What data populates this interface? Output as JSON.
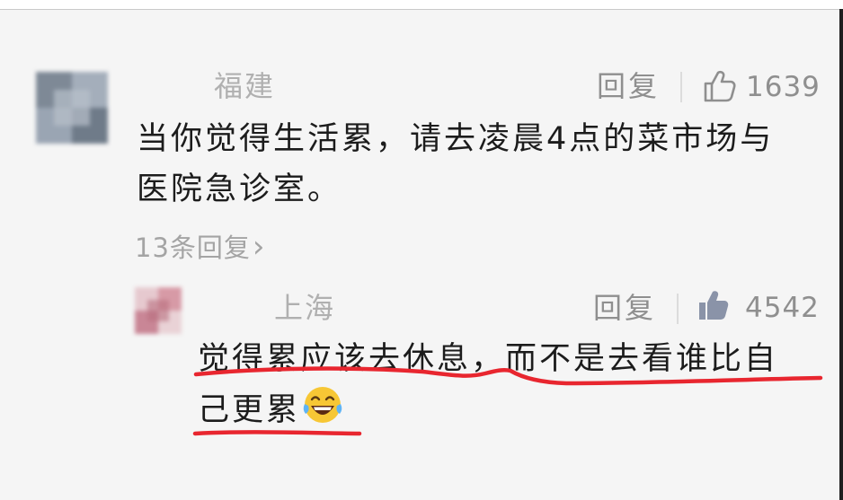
{
  "comment": {
    "username": "福建",
    "reply_label": "回复",
    "like_count": "1639",
    "content_lines": [
      "当你觉得生活累，请去凌晨4点的菜市场与",
      "医院急诊室。"
    ],
    "replies_link": "13条回复",
    "replies_chevron": "›"
  },
  "reply": {
    "username": "上海",
    "reply_label": "回复",
    "like_count": "4542",
    "content_lines": [
      "觉得累应该去休息，而不是去看谁比自",
      "己更累"
    ],
    "emoji": "laughing-crying-emoji"
  },
  "icons": {
    "comment_like": "thumbs-up-outline-icon",
    "reply_like": "thumbs-up-filled-icon"
  },
  "colors": {
    "background": "#f5f5f5",
    "username": "#b0b0b0",
    "meta": "#8f8f8f",
    "text": "#1c1c1c",
    "underline": "#e8262f"
  }
}
